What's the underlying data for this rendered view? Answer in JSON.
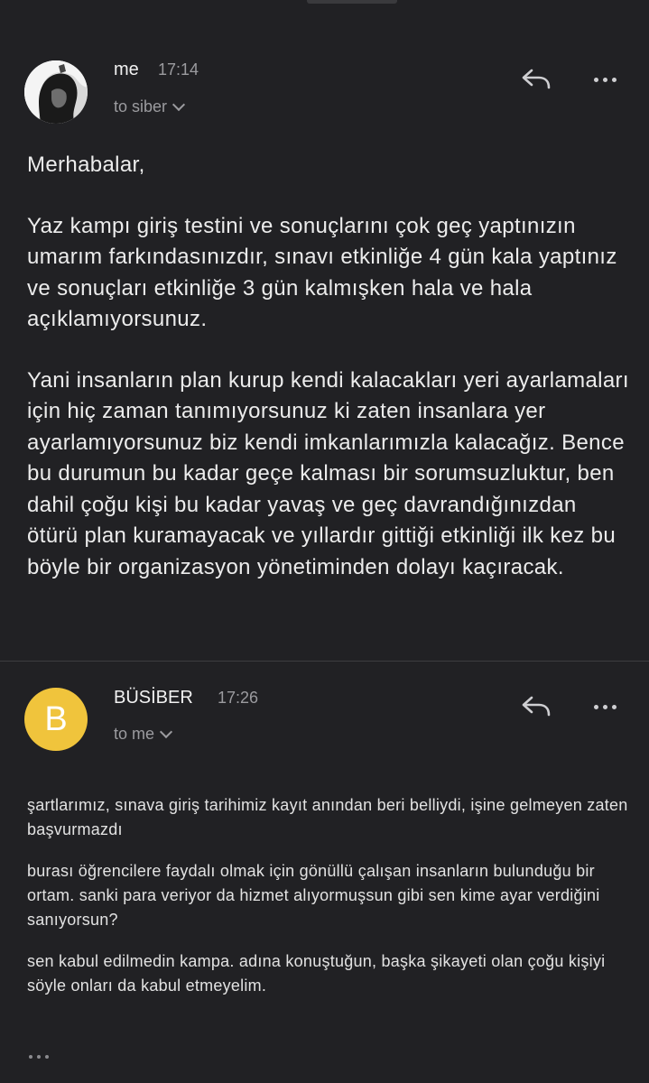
{
  "thread": {
    "messages": [
      {
        "sender": "me",
        "time": "17:14",
        "recipient": "to siber",
        "avatar_icon": "user-photo",
        "paragraphs": [
          "Merhabalar,",
          "Yaz kampı giriş testini ve sonuçlarını çok geç yaptınızın umarım farkındasınızdır, sınavı etkinliğe 4 gün kala yaptınız ve sonuçları etkinliğe 3 gün kalmışken hala ve hala açıklamıyorsunuz.",
          "Yani insanların plan kurup kendi kalacakları yeri ayarlamaları için hiç zaman tanımıyorsunuz ki zaten insanlara yer ayarlamıyorsunuz biz kendi imkanlarımızla kalacağız. Bence bu durumun bu kadar geçe kalması bir sorumsuzluktur, ben dahil çoğu kişi bu kadar yavaş ve geç davrandığınızdan ötürü plan kuramayacak ve yıllardır gittiği etkinliği ilk kez bu böyle bir organizasyon yönetiminden dolayı kaçıracak."
        ]
      },
      {
        "sender": "BÜSİBER",
        "time": "17:26",
        "recipient": "to me",
        "avatar_letter": "B",
        "avatar_color": "#f0c43c",
        "paragraphs": [
          "şartlarımız, sınava giriş tarihimiz kayıt anından beri belliydi, işine gelmeyen zaten başvurmazdı",
          "burası öğrencilere faydalı olmak için gönüllü çalışan insanların bulunduğu bir ortam. sanki para veriyor da hizmet alıyormuşsun gibi sen kime ayar verdiğini sanıyorsun?",
          "sen kabul edilmedin kampa. adına konuştuğun, başka şikayeti olan çoğu kişiyi söyle onları da kabul etmeyelim."
        ]
      }
    ]
  },
  "icons": {
    "reply": "reply-icon",
    "more": "more-options-icon",
    "expand": "chevron-down-icon",
    "show_trimmed": "ellipsis-icon"
  },
  "colors": {
    "background": "#212124",
    "avatar_b": "#f0c43c"
  }
}
